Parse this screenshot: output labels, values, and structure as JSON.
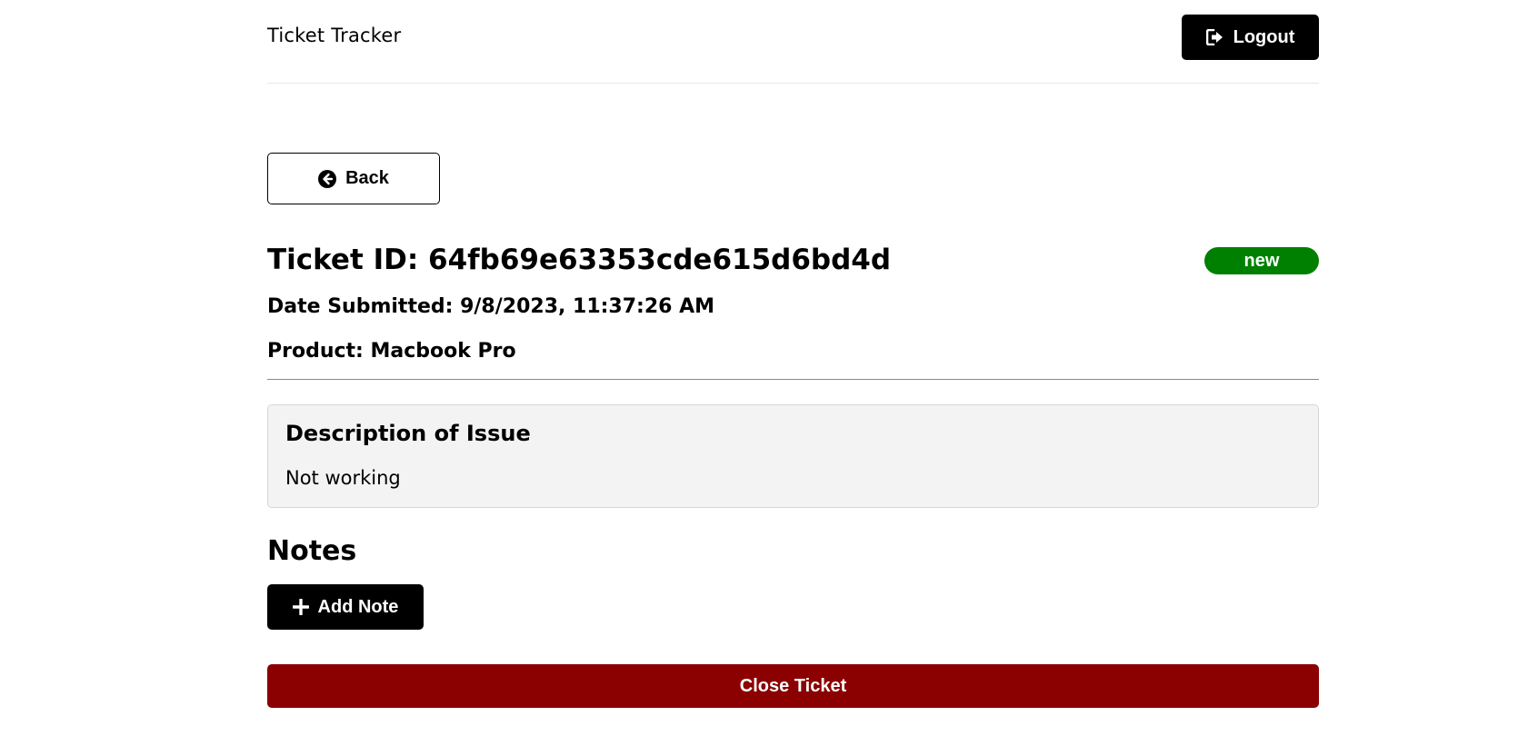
{
  "header": {
    "app_title": "Ticket Tracker",
    "logout_label": "Logout",
    "logout_icon": "sign-out-icon"
  },
  "navigation": {
    "back_label": "Back",
    "back_icon": "arrow-circle-left-icon"
  },
  "ticket": {
    "id_line": "Ticket ID: 64fb69e63353cde615d6bd4d",
    "status": "new",
    "status_color": "#008000",
    "date_line": "Date Submitted: 9/8/2023, 11:37:26 AM",
    "product_line": "Product: Macbook Pro"
  },
  "description": {
    "title": "Description of Issue",
    "text": "Not working"
  },
  "notes": {
    "title": "Notes",
    "add_note_label": "Add Note",
    "add_note_icon": "plus-icon"
  },
  "actions": {
    "close_ticket_label": "Close Ticket",
    "close_ticket_color": "#8b0000"
  }
}
